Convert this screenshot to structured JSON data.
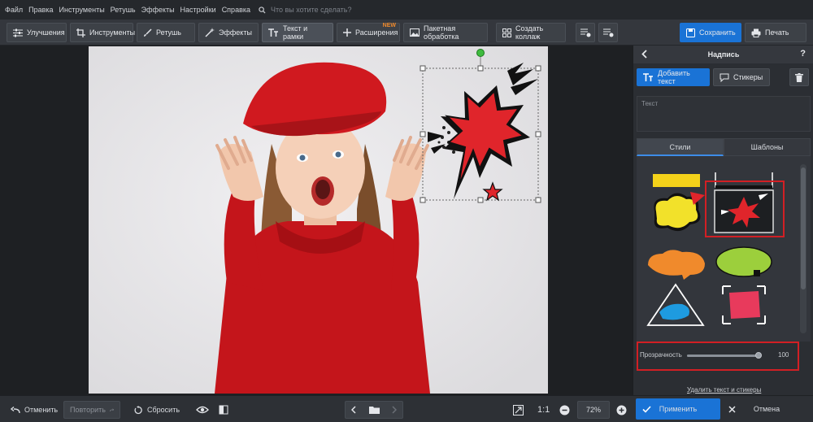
{
  "menu": {
    "items": [
      "Файл",
      "Правка",
      "Инструменты",
      "Ретушь",
      "Эффекты",
      "Настройки",
      "Справка"
    ],
    "search_placeholder": "Что вы хотите сделать?"
  },
  "toolbar": {
    "tabs": [
      {
        "label": "Улучшения",
        "icon": "sliders-icon"
      },
      {
        "label": "Инструменты",
        "icon": "crop-icon"
      },
      {
        "label": "Ретушь",
        "icon": "brush-icon"
      },
      {
        "label": "Эффекты",
        "icon": "magic-wand-icon"
      },
      {
        "label": "Текст и рамки",
        "icon": "text-icon",
        "active": true
      },
      {
        "label": "Расширения",
        "icon": "plus-icon",
        "badge": "NEW"
      }
    ],
    "batch": "Пакетная обработка",
    "collage": "Создать коллаж",
    "save": "Сохранить",
    "print": "Печать"
  },
  "panel": {
    "title": "Надпись",
    "help": "?",
    "add_text": "Добавить текст",
    "stickers": "Стикеры",
    "text_placeholder": "Текст",
    "tab_styles": "Стили",
    "tab_templates": "Шаблоны",
    "opacity_label": "Прозрачность",
    "opacity_value": "100",
    "delete_link": "Удалить текст и стикеры",
    "apply": "Применить",
    "cancel": "Отмена"
  },
  "bottom": {
    "undo": "Отменить",
    "redo": "Повторить",
    "reset": "Сбросить",
    "ratio": "1:1",
    "zoom": "72%"
  },
  "colors": {
    "accent": "#1a73d6",
    "highlight": "#d21f24",
    "sticker_red": "#e0252b"
  }
}
